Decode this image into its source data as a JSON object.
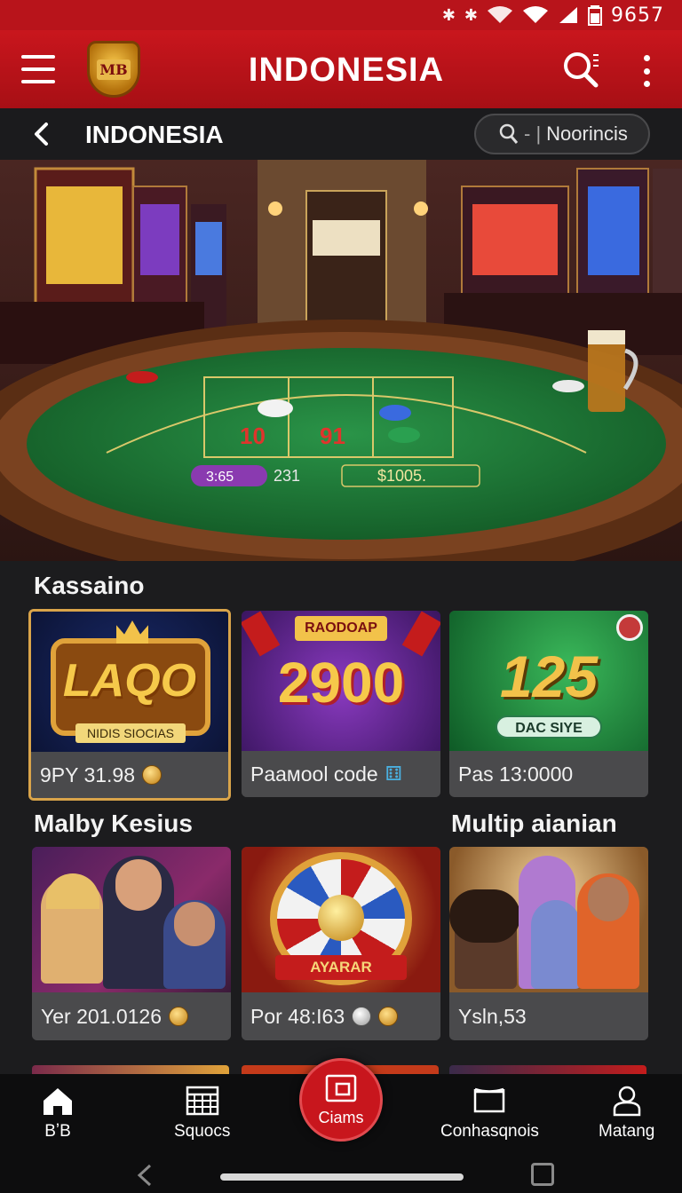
{
  "status_bar": {
    "time": "9657"
  },
  "app_bar": {
    "title": "INDONESIA",
    "logo_text": "MB"
  },
  "sub_bar": {
    "title": "INDONESIA",
    "search_text": "Noorincis"
  },
  "hero": {
    "table_numbers": [
      "10",
      "91"
    ],
    "table_badge": "3:65",
    "table_value_mid": "231",
    "table_value_right": "$1005."
  },
  "sections": {
    "casino_title": "Kassaino",
    "lounge_title": "Malby Kesius",
    "multi_title": "Multip aianian"
  },
  "casino_cards": [
    {
      "art_title": "LAQO",
      "art_sub": "NIDIS SIOCIAS",
      "caption": "9PY 31.98"
    },
    {
      "art_title": "2900",
      "art_sub": "RAODOAP",
      "caption": "Paaмool code"
    },
    {
      "art_title": "125",
      "art_sub": "DAC SIYE",
      "caption": "Pas 13:0000"
    }
  ],
  "social_cards": [
    {
      "caption": "Yer 201.0126"
    },
    {
      "art_sub": "AYARAR",
      "caption": "Por 48:I63"
    },
    {
      "caption": "Ysln,53"
    }
  ],
  "bottom_nav": {
    "home": "BʼB",
    "slots": "Squocs",
    "claims": "Ciams",
    "connections": "Conhasqnois",
    "profile": "Matang"
  },
  "colors": {
    "brand_red": "#c8161d",
    "table_green": "#1f7a3a",
    "gold": "#d9a44a"
  }
}
